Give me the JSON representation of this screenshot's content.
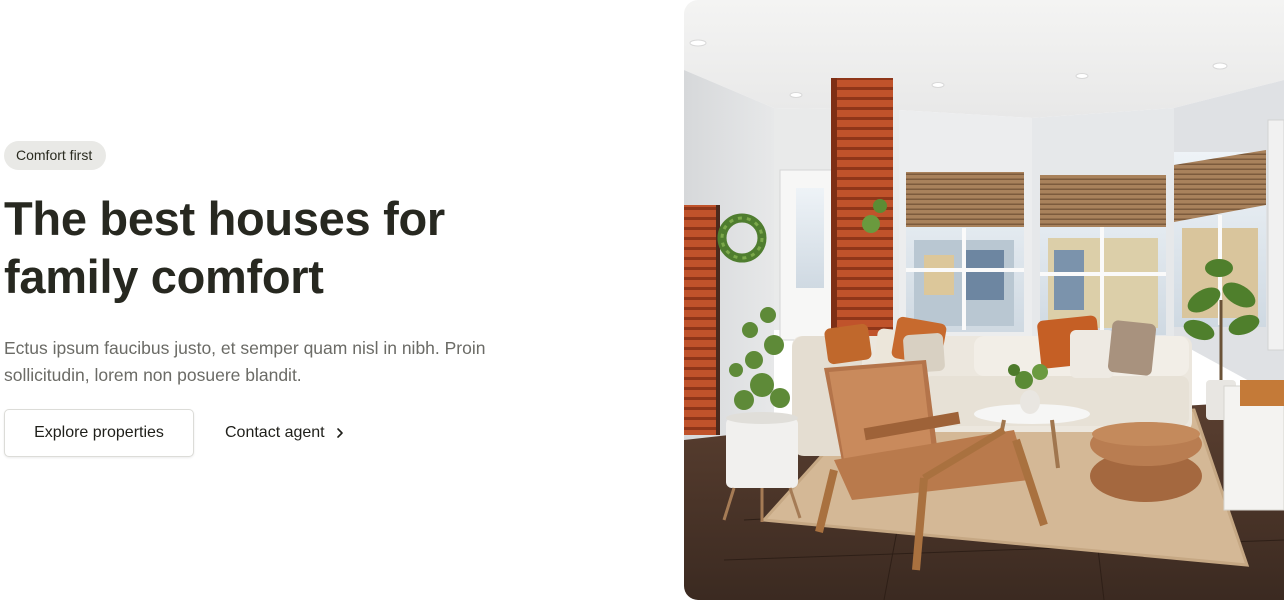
{
  "hero": {
    "badge": "Comfort first",
    "title_line1": "The best houses for",
    "title_line2": "family comfort",
    "description_line1": "Ectus ipsum faucibus justo, et semper quam nisl in nibh. Proin",
    "description_line2": "sollicitudin, lorem non posuere blandit.",
    "primary_button": "Explore properties",
    "secondary_button": "Contact agent"
  },
  "colors": {
    "heading": "#272820",
    "body_text": "#6b6b66",
    "badge_bg": "#e9e9e6",
    "accent_wood": "#c0532b"
  },
  "icons": {
    "secondary_button_icon": "chevron-right-icon"
  }
}
